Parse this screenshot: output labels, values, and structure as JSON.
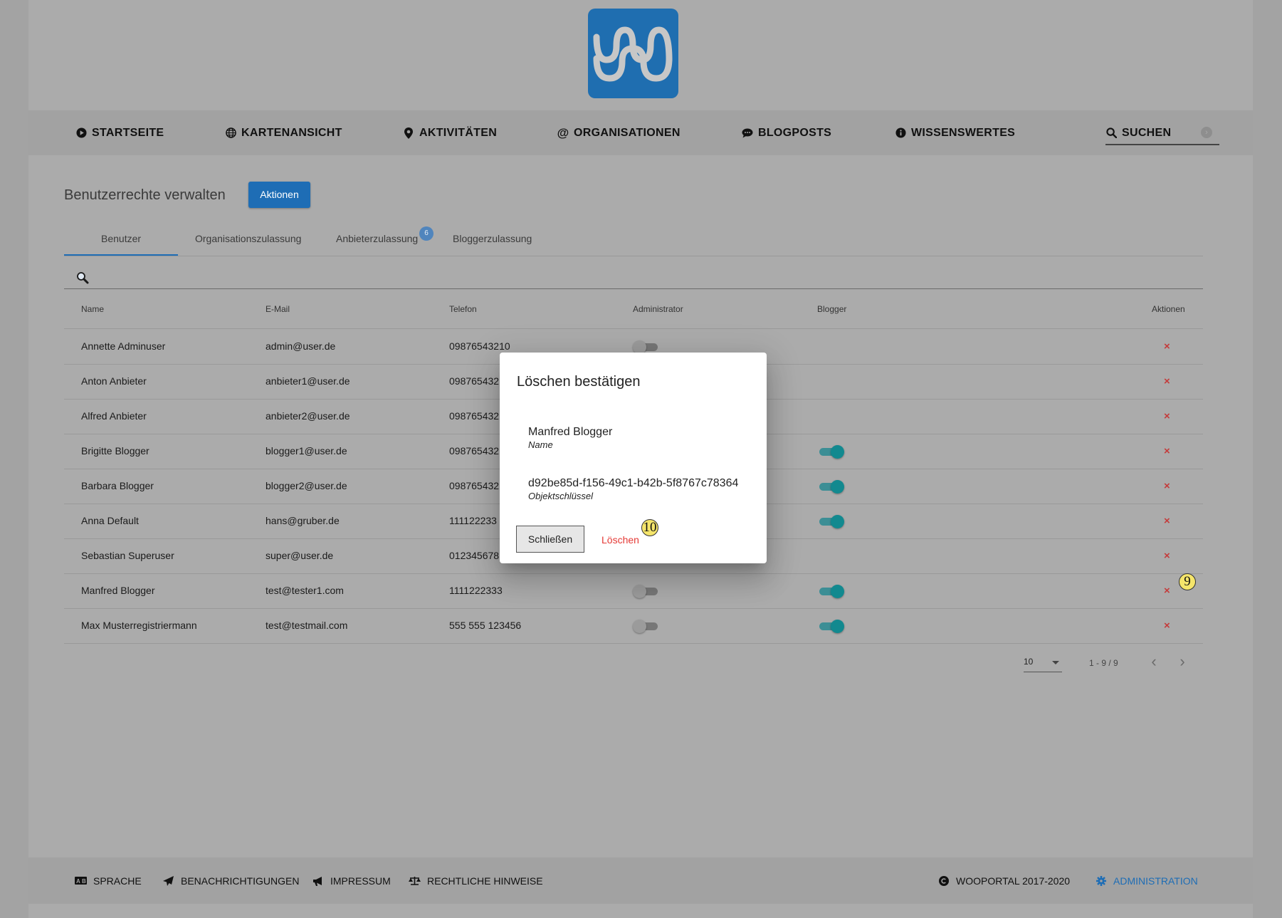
{
  "nav": {
    "items": [
      {
        "label": "STARTSEITE",
        "icon": "play-circle-icon"
      },
      {
        "label": "KARTENANSICHT",
        "icon": "globe-icon"
      },
      {
        "label": "AKTIVITÄTEN",
        "icon": "map-pin-icon"
      },
      {
        "label": "ORGANISATIONEN",
        "icon": "at-icon"
      },
      {
        "label": "BLOGPOSTS",
        "icon": "comment-icon"
      },
      {
        "label": "WISSENSWERTES",
        "icon": "info-circle-icon"
      }
    ],
    "search_label": "SUCHEN"
  },
  "page": {
    "title": "Benutzerrechte verwalten",
    "actions_label": "Aktionen"
  },
  "tabs": [
    {
      "label": "Benutzer",
      "active": true
    },
    {
      "label": "Organisationszulassung"
    },
    {
      "label": "Anbieterzulassung",
      "badge": "6"
    },
    {
      "label": "Bloggerzulassung"
    }
  ],
  "table": {
    "headers": [
      "Name",
      "E-Mail",
      "Telefon",
      "Administrator",
      "Blogger",
      "Aktionen"
    ],
    "rows": [
      {
        "name": "Annette Adminuser",
        "email": "admin@user.de",
        "phone": "09876543210",
        "admin": false,
        "blogger": null
      },
      {
        "name": "Anton Anbieter",
        "email": "anbieter1@user.de",
        "phone": "098765432",
        "admin": null,
        "blogger": null
      },
      {
        "name": "Alfred Anbieter",
        "email": "anbieter2@user.de",
        "phone": "098765432",
        "admin": null,
        "blogger": null
      },
      {
        "name": "Brigitte Blogger",
        "email": "blogger1@user.de",
        "phone": "098765432",
        "admin": null,
        "blogger": true
      },
      {
        "name": "Barbara Blogger",
        "email": "blogger2@user.de",
        "phone": "098765432",
        "admin": null,
        "blogger": true
      },
      {
        "name": "Anna Default",
        "email": "hans@gruber.de",
        "phone": "111122233",
        "admin": null,
        "blogger": true
      },
      {
        "name": "Sebastian Superuser",
        "email": "super@user.de",
        "phone": "012345678",
        "admin": null,
        "blogger": null
      },
      {
        "name": "Manfred Blogger",
        "email": "test@tester1.com",
        "phone": "1111222333",
        "admin": false,
        "blogger": true
      },
      {
        "name": "Max Musterregistriermann",
        "email": "test@testmail.com",
        "phone": "555 555 123456",
        "admin": false,
        "blogger": true
      }
    ],
    "delete_glyph": "×"
  },
  "paginator": {
    "page_size": "10",
    "range": "1 - 9 / 9"
  },
  "footer": {
    "items": [
      {
        "label": "SPRACHE",
        "icon": "language-icon"
      },
      {
        "label": "BENACHRICHTIGUNGEN",
        "icon": "paper-plane-icon"
      },
      {
        "label": "IMPRESSUM",
        "icon": "megaphone-icon"
      },
      {
        "label": "RECHTLICHE HINWEISE",
        "icon": "scale-icon"
      }
    ],
    "copyright": "WOOPORTAL 2017-2020",
    "admin": "ADMINISTRATION"
  },
  "dialog": {
    "title": "Löschen bestätigen",
    "name_value": "Manfred Blogger",
    "name_label": "Name",
    "key_value": "d92be85d-f156-49c1-b42b-5f8767c78364",
    "key_label": "Objektschlüssel",
    "close_label": "Schließen",
    "delete_label": "Löschen"
  },
  "markers": [
    "10",
    "9"
  ],
  "colors": {
    "accent": "#1e6db5",
    "toggle_on": "#12898f",
    "delete": "#c43b3b",
    "dialog_delete": "#e53935",
    "backdrop": "#ababab"
  }
}
